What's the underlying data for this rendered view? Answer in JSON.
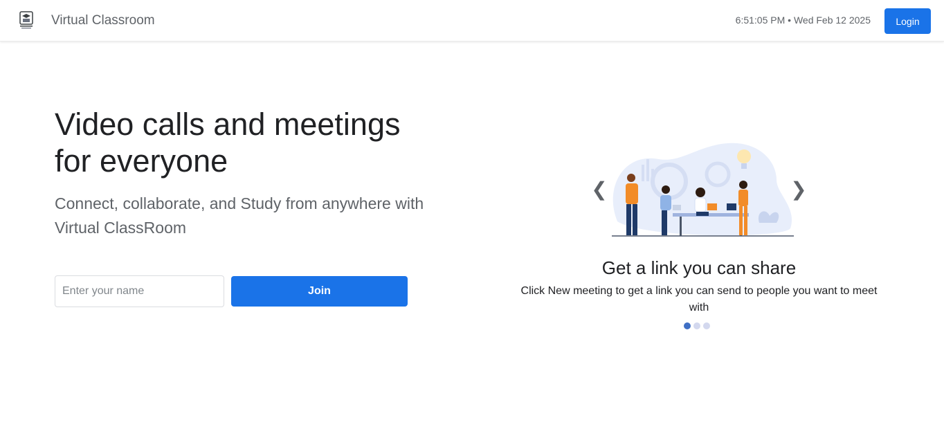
{
  "header": {
    "title": "Virtual Classroom",
    "datetime": "6:51:05 PM • Wed Feb 12 2025",
    "login_label": "Login",
    "logo_icon": "school-crest-icon"
  },
  "hero": {
    "title": "Video calls and meetings for everyone",
    "subtitle": "Connect, collaborate, and Study from anywhere with Virtual ClassRoom",
    "name_input": {
      "value": "",
      "placeholder": "Enter your name"
    },
    "join_label": "Join"
  },
  "carousel": {
    "prev_icon": "chevron-left-icon",
    "next_icon": "chevron-right-icon",
    "prev_glyph": "❮",
    "next_glyph": "❯",
    "slide_title": "Get a link you can share",
    "slide_text": "Click New meeting to get a link you can send to people you want to meet with",
    "active_slide": 1,
    "slide_count": 3
  },
  "colors": {
    "accent": "#1a73e8",
    "dot_active": "#3f6fc4",
    "dot_inactive": "#d3d8ee",
    "illustration_bg": "#e8eefb",
    "figure_orange": "#f28c28",
    "figure_navy": "#1f3a68"
  }
}
